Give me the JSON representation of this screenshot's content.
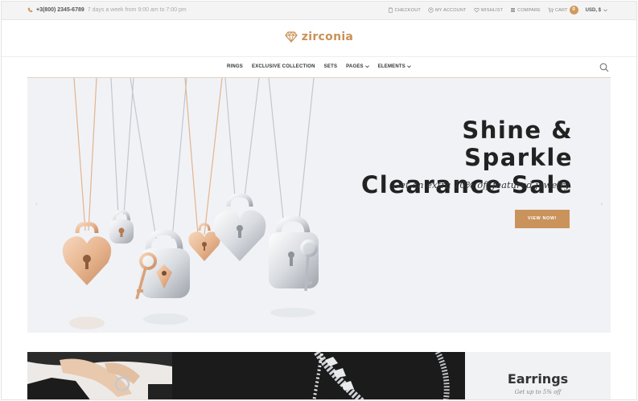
{
  "topbar": {
    "phone": "+3(800) 2345-6789",
    "hours": "7 days a week from 9:00 am to 7:00 pm",
    "links": [
      {
        "label": "CHECKOUT",
        "icon": "clipboard-icon"
      },
      {
        "label": "MY ACCOUNT",
        "icon": "account-icon"
      },
      {
        "label": "WISHLIST",
        "icon": "heart-icon"
      },
      {
        "label": "COMPARE",
        "icon": "compare-icon"
      },
      {
        "label": "CART",
        "icon": "cart-icon"
      }
    ],
    "cart_count": "0",
    "currency": "USD, $"
  },
  "logo": {
    "text": "zirconia",
    "icon": "diamond-icon"
  },
  "nav": {
    "items": [
      {
        "label": "RINGS",
        "dropdown": false
      },
      {
        "label": "EXCLUSIVE COLLECTION",
        "dropdown": false
      },
      {
        "label": "SETS",
        "dropdown": false
      },
      {
        "label": "PAGES",
        "dropdown": true
      },
      {
        "label": "ELEMENTS",
        "dropdown": true
      }
    ],
    "search_icon": "search-icon"
  },
  "hero": {
    "title_line1": "Shine & Sparkle",
    "title_line2": "Clearance Sale",
    "subtitle": "Get an extra 10% off featured jewelry",
    "button": "VIEW NOW!"
  },
  "banners": {
    "earrings_title": "Earrings",
    "earrings_sub": "Get up to 5% off"
  },
  "colors": {
    "accent": "#c9935b",
    "hero_bg": "#f0f2f5",
    "topbar_bg": "#f4f4f4"
  }
}
